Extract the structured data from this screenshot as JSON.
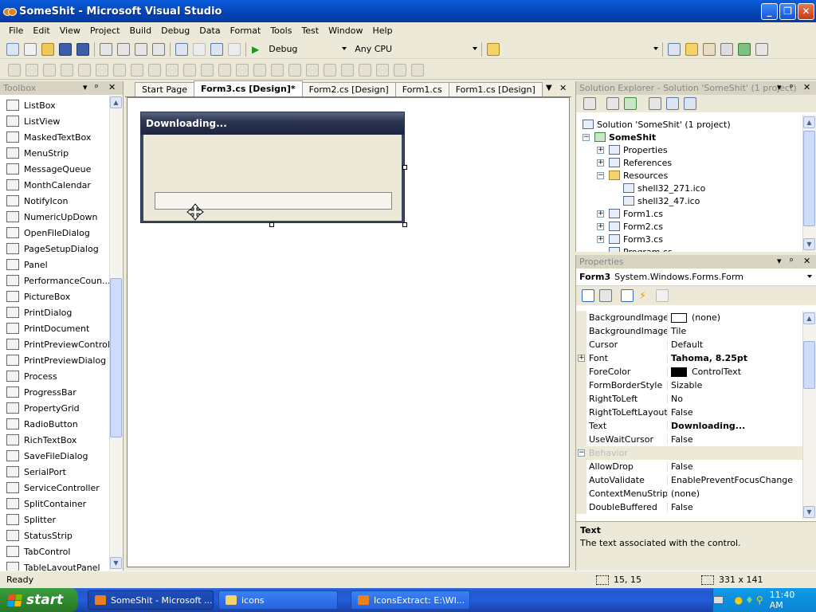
{
  "window": {
    "title": "SomeShit - Microsoft Visual Studio",
    "min": "_",
    "max": "❐",
    "close": "✕"
  },
  "menu": [
    "File",
    "Edit",
    "View",
    "Project",
    "Build",
    "Debug",
    "Data",
    "Format",
    "Tools",
    "Test",
    "Window",
    "Help"
  ],
  "toolbar": {
    "config": "Debug",
    "platform": "Any CPU"
  },
  "toolbox": {
    "title": "Toolbox",
    "items": [
      "ListBox",
      "ListView",
      "MaskedTextBox",
      "MenuStrip",
      "MessageQueue",
      "MonthCalendar",
      "NotifyIcon",
      "NumericUpDown",
      "OpenFileDialog",
      "PageSetupDialog",
      "Panel",
      "PerformanceCoun...",
      "PictureBox",
      "PrintDialog",
      "PrintDocument",
      "PrintPreviewControl",
      "PrintPreviewDialog",
      "Process",
      "ProgressBar",
      "PropertyGrid",
      "RadioButton",
      "RichTextBox",
      "SaveFileDialog",
      "SerialPort",
      "ServiceController",
      "SplitContainer",
      "Splitter",
      "StatusStrip",
      "TabControl",
      "TableLayoutPanel"
    ]
  },
  "tabs": [
    "Start Page",
    "Form3.cs [Design]*",
    "Form2.cs [Design]",
    "Form1.cs",
    "Form1.cs [Design]"
  ],
  "designer": {
    "form_title": "Downloading..."
  },
  "solution_explorer": {
    "title": "Solution Explorer - Solution 'SomeShit' (1 project)",
    "nodes": [
      {
        "label": "Solution 'SomeShit' (1 project)",
        "level": 0,
        "expander": ""
      },
      {
        "label": "SomeShit",
        "level": 0,
        "expander": "−",
        "bold": true
      },
      {
        "label": "Properties",
        "level": 1,
        "expander": "+"
      },
      {
        "label": "References",
        "level": 1,
        "expander": "+"
      },
      {
        "label": "Resources",
        "level": 1,
        "expander": "−"
      },
      {
        "label": "shell32_271.ico",
        "level": 2,
        "expander": ""
      },
      {
        "label": "shell32_47.ico",
        "level": 2,
        "expander": ""
      },
      {
        "label": "Form1.cs",
        "level": 1,
        "expander": "+"
      },
      {
        "label": "Form2.cs",
        "level": 1,
        "expander": "+"
      },
      {
        "label": "Form3.cs",
        "level": 1,
        "expander": "+"
      },
      {
        "label": "Program.cs",
        "level": 1,
        "expander": ""
      }
    ]
  },
  "properties": {
    "title": "Properties",
    "object_name": "Form3",
    "object_type": "System.Windows.Forms.Form",
    "rows": [
      {
        "name": "BackgroundImage",
        "value": "(none)",
        "swatch": "#ffffff"
      },
      {
        "name": "BackgroundImageLayo",
        "value": "Tile"
      },
      {
        "name": "Cursor",
        "value": "Default"
      },
      {
        "name": "Font",
        "value": "Tahoma, 8.25pt",
        "bold": true,
        "expander": "+"
      },
      {
        "name": "ForeColor",
        "value": "ControlText",
        "swatch": "#000000"
      },
      {
        "name": "FormBorderStyle",
        "value": "Sizable"
      },
      {
        "name": "RightToLeft",
        "value": "No"
      },
      {
        "name": "RightToLeftLayout",
        "value": "False"
      },
      {
        "name": "Text",
        "value": "Downloading...",
        "bold": true
      },
      {
        "name": "UseWaitCursor",
        "value": "False"
      },
      {
        "name": "Behavior",
        "value": "",
        "category": true
      },
      {
        "name": "AllowDrop",
        "value": "False"
      },
      {
        "name": "AutoValidate",
        "value": "EnablePreventFocusChange"
      },
      {
        "name": "ContextMenuStrip",
        "value": "(none)"
      },
      {
        "name": "DoubleBuffered",
        "value": "False"
      }
    ],
    "desc_title": "Text",
    "desc_text": "The text associated with the control."
  },
  "status": {
    "ready": "Ready",
    "position": "15, 15",
    "size": "331 x 141"
  },
  "taskbar": {
    "start": "start",
    "tasks": [
      "SomeShit - Microsoft ...",
      "icons",
      "IconsExtract:  E:\\WI..."
    ],
    "clock": "11:40 AM"
  }
}
